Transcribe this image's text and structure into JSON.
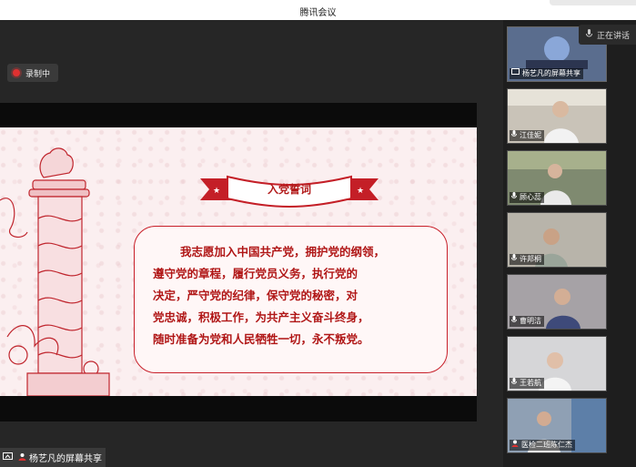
{
  "window": {
    "title": "腾讯会议"
  },
  "recording": {
    "label": "录制中"
  },
  "slide": {
    "heading": "入党誓词",
    "oath_lines": [
      "我志愿加入中国共产党，拥护党的纲领，",
      "遵守党的章程，履行党员义务，执行党的",
      "决定，严守党的纪律，保守党的秘密，对",
      "党忠诚，积极工作，为共产主义奋斗终身，",
      "随时准备为党和人民牺牲一切，永不叛党。"
    ]
  },
  "presenter": {
    "label": "杨艺凡的屏幕共享"
  },
  "speaking": {
    "label": "正在讲话"
  },
  "participants": [
    {
      "name": "杨艺凡的屏幕共享",
      "type": "screen-share"
    },
    {
      "name": "江佳妮",
      "type": "camera"
    },
    {
      "name": "顾心蕊",
      "type": "camera"
    },
    {
      "name": "许邦桐",
      "type": "camera"
    },
    {
      "name": "曹明洁",
      "type": "camera"
    },
    {
      "name": "王若航",
      "type": "camera"
    },
    {
      "name": "医检二班陈仁杰",
      "type": "camera"
    }
  ],
  "colors": {
    "oath_red": "#b01616",
    "slide_bg": "#fbeff0",
    "app_bg": "#242424"
  }
}
